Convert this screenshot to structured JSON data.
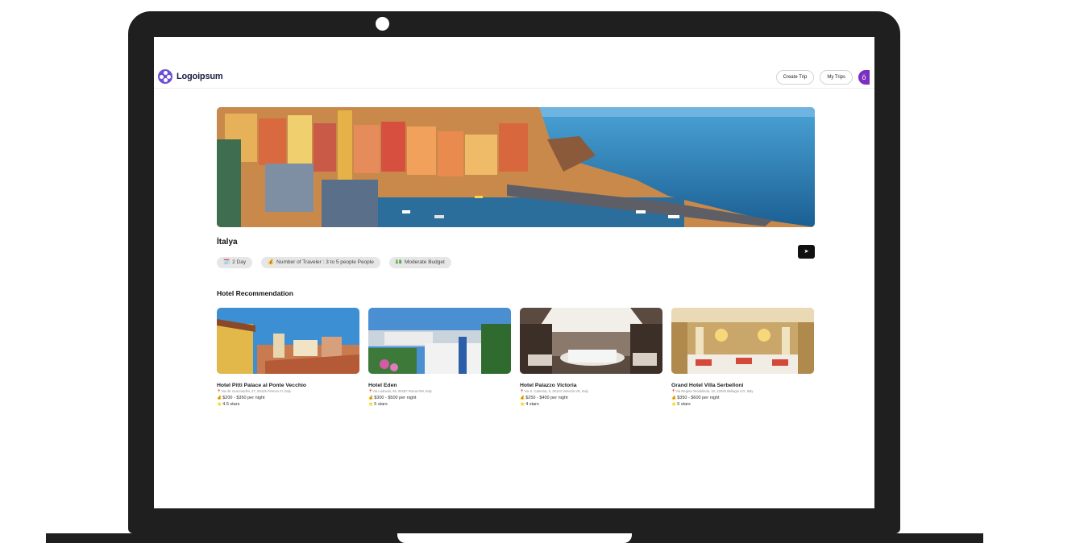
{
  "app": {
    "logo_text": "Logoipsum"
  },
  "nav": {
    "create_trip": "Create Trip",
    "my_trips": "My Trips",
    "avatar_initial": "ö"
  },
  "trip": {
    "destination": "İtalya",
    "chips": [
      {
        "icon": "🗓️",
        "label": "2 Day"
      },
      {
        "icon": "💰",
        "label": "Number of Traveler : 3 to 5 people People"
      },
      {
        "icon": "💵",
        "label": "Moderate Budget"
      }
    ],
    "share_label": "➤"
  },
  "hotels": {
    "section_title": "Hotel Recommendation",
    "items": [
      {
        "name": "Hotel Pitti Palace al Ponte Vecchio",
        "address": "Via de' Guicciardini, 27, 50125 Firenze FI, Italy",
        "price": "$200 - $350 per night",
        "rating": "4.5 stars"
      },
      {
        "name": "Hotel Eden",
        "address": "Via Ludovisi, 49, 00187 Roma RM, Italy",
        "price": "$300 - $500 per night",
        "rating": "5 stars"
      },
      {
        "name": "Hotel Palazzo Victoria",
        "address": "Via S. Caterina, 5, 30124 Venezia VE, Italy",
        "price": "$250 - $400 per night",
        "rating": "4 stars"
      },
      {
        "name": "Grand Hotel Villa Serbelloni",
        "address": "Via Regina Teodolinda, 10, 22029 Bellagio CO, Italy",
        "price": "$350 - $600 per night",
        "rating": "5 stars"
      }
    ]
  },
  "colors": {
    "laptop_frame": "#1f1f1f",
    "logo": "#6c4fd6",
    "avatar": "#7b2fbf"
  }
}
